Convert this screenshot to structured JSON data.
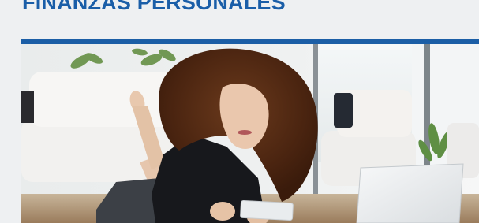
{
  "section": {
    "title": "FINANZAS PERSONALES"
  },
  "colors": {
    "title_text": "#1a5ea8",
    "accent_rule": "#1b5ea6",
    "page_background": "#eef0f2"
  },
  "hero_image": {
    "icon": "photo-woman-with-card-and-laptop"
  }
}
